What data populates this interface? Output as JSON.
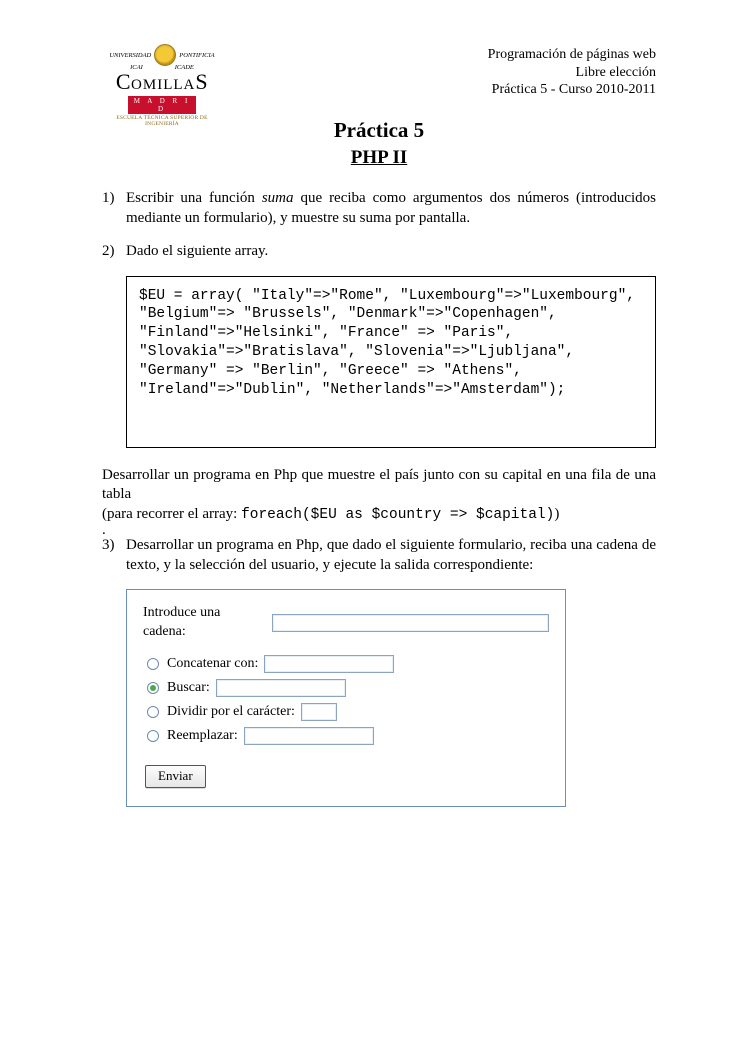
{
  "logo": {
    "arc_left": "UNIVERSIDAD",
    "arc_right": "PONTIFICIA",
    "icai": "ICAI",
    "icade": "ICADE",
    "name_c": "C",
    "name_mid": "OMILLA",
    "name_s": "S",
    "madrid": "M A D R I D",
    "sub": "ESCUELA TÉCNICA SUPERIOR DE INGENIERÍA"
  },
  "header": {
    "line1": "Programación de páginas web",
    "line2": "Libre elección",
    "line3": "Práctica 5 - Curso 2010-2011"
  },
  "title": {
    "main": "Práctica 5",
    "sub": "PHP II"
  },
  "q1": {
    "num": "1)",
    "pre": "Escribir una función ",
    "em": "suma",
    "post": " que reciba como argumentos dos números (introducidos mediante un formulario), y muestre su suma por pantalla."
  },
  "q2": {
    "num": "2)",
    "text": "Dado el siguiente array."
  },
  "code": "$EU = array( \"Italy\"=>\"Rome\", \"Luxembourg\"=>\"Luxembourg\", \"Belgium\"=> \"Brussels\", \"Denmark\"=>\"Copenhagen\", \"Finland\"=>\"Helsinki\", \"France\" => \"Paris\", \"Slovakia\"=>\"Bratislava\", \"Slovenia\"=>\"Ljubljana\", \"Germany\" => \"Berlin\", \"Greece\" => \"Athens\", \"Ireland\"=>\"Dublin\", \"Netherlands\"=>\"Amsterdam\");",
  "para1": "Desarrollar un programa en Php que muestre el país junto con su capital en una fila de una tabla",
  "para2_pre": "(para recorrer el array: ",
  "para2_code": "foreach($EU as $country => $capital)",
  "para2_post": ")",
  "dot": ".",
  "q3": {
    "num": "3)",
    "text": "Desarrollar un programa en Php, que dado el siguiente formulario, reciba una cadena de texto, y la selección del usuario, y ejecute la salida correspondiente:"
  },
  "form": {
    "intro": "Introduce una cadena:",
    "opt1": "Concatenar con:",
    "opt2": "Buscar:",
    "opt3": "Dividir por el carácter:",
    "opt4": "Reemplazar:",
    "submit": "Enviar"
  }
}
